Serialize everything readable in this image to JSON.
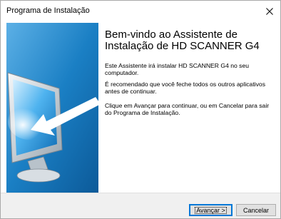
{
  "window": {
    "title": "Programa de Instalação"
  },
  "banner": {
    "icon": "monitor-arrow-illustration"
  },
  "main": {
    "heading": "Bem-vindo ao Assistente de Instalação de HD SCANNER G4",
    "paragraphs": [
      "Este Assistente irá instalar HD SCANNER G4 no seu computador.",
      "É recomendado que você feche todos os outros aplicativos antes de continuar.",
      "Clique em Avançar para continuar, ou em Cancelar para sair do Programa de Instalação."
    ]
  },
  "footer": {
    "next_label": "Avançar >",
    "cancel_label": "Cancelar"
  },
  "colors": {
    "banner_blue": "#1a7fc4",
    "accent": "#0078d7"
  }
}
